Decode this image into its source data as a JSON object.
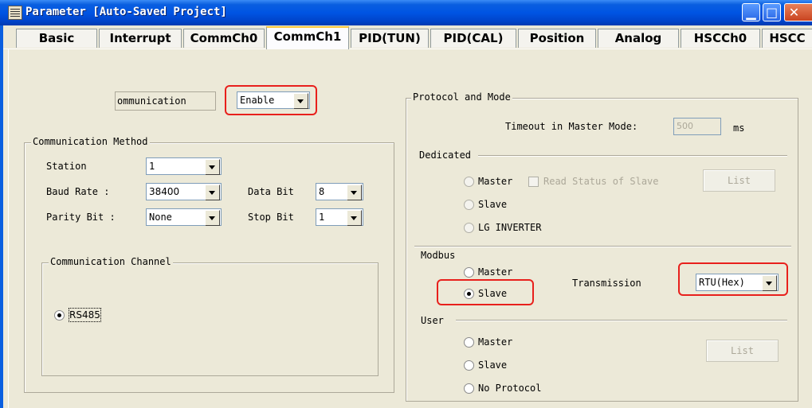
{
  "window": {
    "title": "Parameter [Auto-Saved Project]"
  },
  "tabs": [
    "Basic",
    "Interrupt",
    "CommCh0",
    "CommCh1",
    "PID(TUN)",
    "PID(CAL)",
    "Position",
    "Analog",
    "HSCCh0",
    "HSCC"
  ],
  "communication": {
    "label": "ommunication",
    "value": "Enable"
  },
  "method": {
    "title": "Communication Method",
    "station_label": "Station",
    "station_value": "1",
    "baud_label": "Baud Rate :",
    "baud_value": "38400",
    "databit_label": "Data Bit",
    "databit_value": "8",
    "parity_label": "Parity Bit :",
    "parity_value": "None",
    "stopbit_label": "Stop Bit",
    "stopbit_value": "1"
  },
  "channel": {
    "title": "Communication Channel",
    "option": "RS485"
  },
  "protocol": {
    "title": "Protocol and Mode",
    "timeout_label": "Timeout in Master Mode:",
    "timeout_value": "500",
    "timeout_unit": "ms",
    "dedicated": {
      "title": "Dedicated",
      "master": "Master",
      "read_status": "Read Status of Slave",
      "list": "List",
      "slave": "Slave",
      "lg": "LG INVERTER"
    },
    "modbus": {
      "title": "Modbus",
      "master": "Master",
      "slave": "Slave",
      "transmission_label": "Transmission",
      "transmission_value": "RTU(Hex)"
    },
    "user": {
      "title": "User",
      "master": "Master",
      "slave": "Slave",
      "noproto": "No Protocol",
      "list": "List"
    }
  },
  "colors": {
    "highlight": "#e8201c",
    "titlebar": "#0054e3"
  }
}
